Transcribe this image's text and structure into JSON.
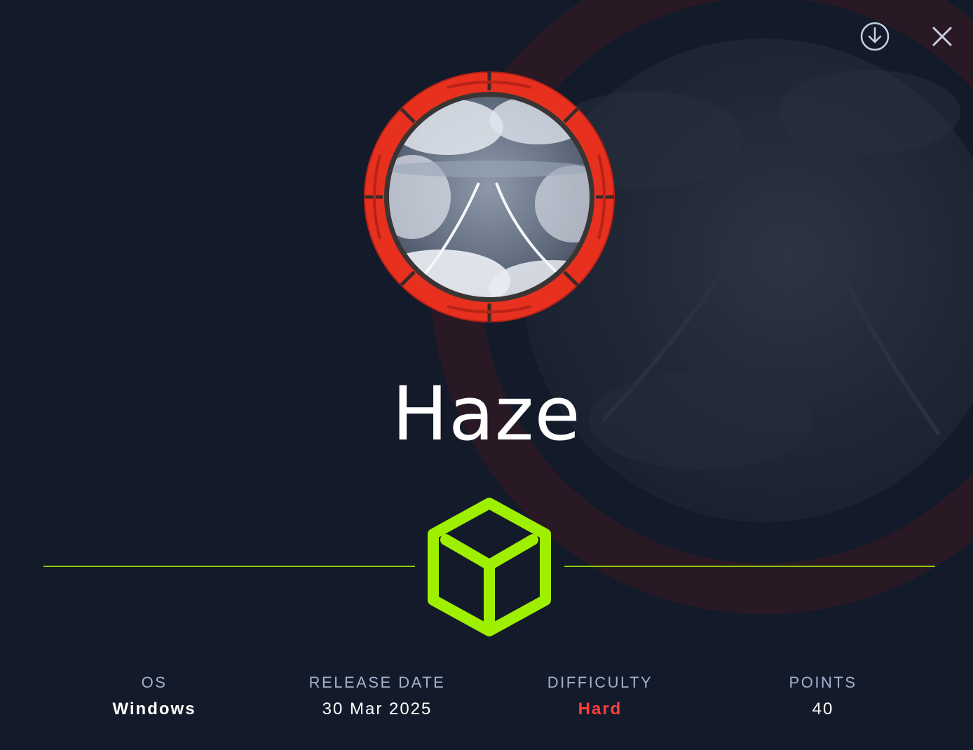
{
  "machine": {
    "name": "Haze"
  },
  "toolbar": {
    "download_icon": "download-icon",
    "close_icon": "close-icon"
  },
  "stats": [
    {
      "label": "OS",
      "value": "Windows"
    },
    {
      "label": "RELEASE DATE",
      "value": "30 Mar 2025"
    },
    {
      "label": "DIFFICULTY",
      "value": "Hard"
    },
    {
      "label": "POINTS",
      "value": "40"
    }
  ],
  "colors": {
    "background": "#131b2a",
    "accent_green": "#9fef00",
    "difficulty_hard": "#ff3e3e",
    "avatar_ring": "#e8301f",
    "label_muted": "#a4b1cd"
  }
}
